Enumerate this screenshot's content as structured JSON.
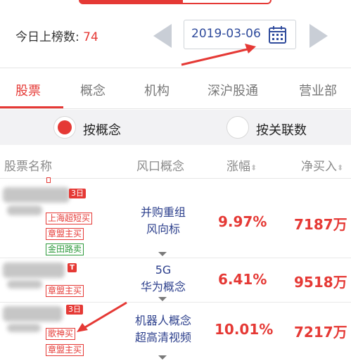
{
  "header": {
    "count_label": "今日上榜数: ",
    "count_value": "74",
    "date": "2019-03-06"
  },
  "tabs": [
    {
      "label": "股票",
      "active": true
    },
    {
      "label": "概念",
      "active": false
    },
    {
      "label": "机构",
      "active": false
    },
    {
      "label": "深沪股通",
      "active": false
    },
    {
      "label": "营业部",
      "active": false
    }
  ],
  "filter": {
    "option_concept": "按概念",
    "option_related": "按关联数",
    "selected": "按概念"
  },
  "columns": {
    "name": "股票名称",
    "concept": "风口概念",
    "change": "涨幅",
    "net_buy": "净买入"
  },
  "rows": [
    {
      "badge": "3日",
      "tags": [
        "上海超短买",
        "章盟主买",
        "金田路卖"
      ],
      "concept_lines": [
        "并购重组",
        "风向标"
      ],
      "change": "9.97%",
      "net_buy": "7187万"
    },
    {
      "badge": "T",
      "tags": [
        "章盟主买"
      ],
      "concept_lines": [
        "5G",
        "华为概念"
      ],
      "change": "6.41%",
      "net_buy": "9518万"
    },
    {
      "badge": "3日",
      "tags": [
        "歌神买",
        "章盟主买"
      ],
      "concept_lines": [
        "机器人概念",
        "超高清视频"
      ],
      "change": "10.01%",
      "net_buy": "7217万"
    }
  ],
  "colors": {
    "accent": "#e53935",
    "concept_text": "#2c3f8c",
    "date_text": "#2f4b9c",
    "sell_tag": "#2e9a3c"
  },
  "icons": [
    "calendar-icon",
    "prev-date-arrow-icon",
    "next-date-arrow-icon",
    "sort-icon",
    "expand-caret-icon"
  ]
}
